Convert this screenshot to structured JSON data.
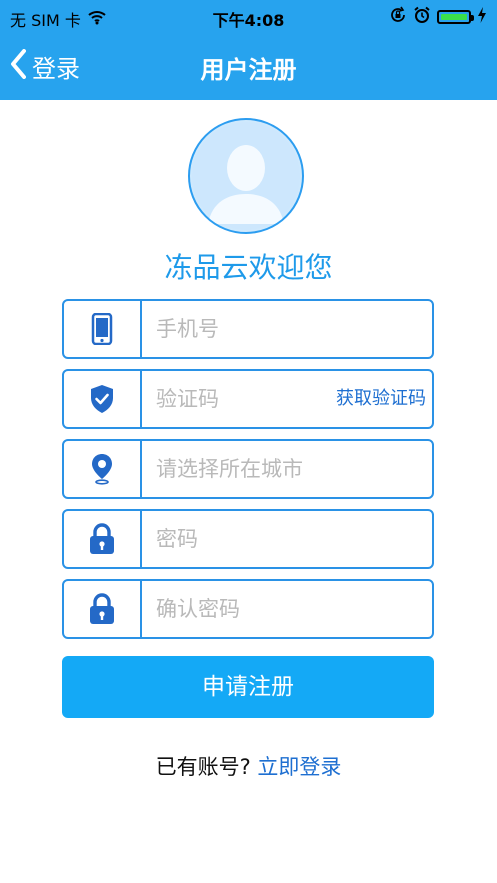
{
  "status_bar": {
    "carrier": "无 SIM 卡",
    "time": "下午4:08",
    "icons": [
      "wifi-icon",
      "orientation-lock-icon",
      "alarm-icon",
      "battery-icon",
      "charging-bolt-icon"
    ]
  },
  "nav": {
    "back_label": "登录",
    "title": "用户注册",
    "background": "#27a3ee"
  },
  "welcome": "冻品云欢迎您",
  "fields": {
    "phone": {
      "placeholder": "手机号",
      "value": "",
      "icon": "phone-icon"
    },
    "code": {
      "placeholder": "验证码",
      "value": "",
      "icon": "shield-check-icon",
      "action_label": "获取验证码"
    },
    "city": {
      "placeholder": "请选择所在城市",
      "value": "",
      "icon": "location-pin-icon"
    },
    "password": {
      "placeholder": "密码",
      "value": "",
      "icon": "lock-icon"
    },
    "confirm_password": {
      "placeholder": "确认密码",
      "value": "",
      "icon": "lock-icon"
    }
  },
  "submit_label": "申请注册",
  "footer": {
    "prompt": "已有账号?",
    "login_link": "立即登录"
  },
  "colors": {
    "accent": "#27a3ee",
    "field_border": "#2a92e6",
    "button": "#14a9f6",
    "link": "#1e6fd1"
  }
}
